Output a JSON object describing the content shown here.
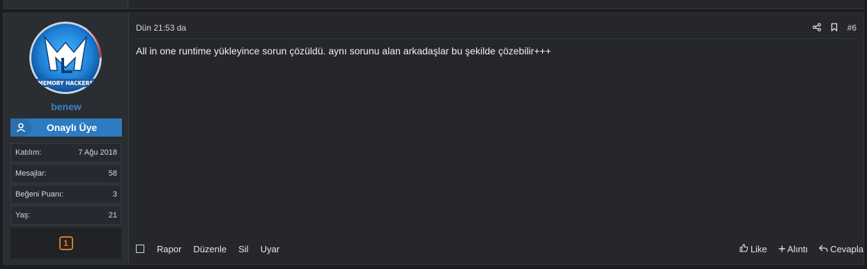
{
  "post": {
    "author": {
      "username": "benew",
      "avatar_text": "MEMORY HACKERS",
      "banner": "Onaylı Üye",
      "stats": [
        {
          "label": "Katılım:",
          "value": "7 Ağu 2018"
        },
        {
          "label": "Mesajlar:",
          "value": "58"
        },
        {
          "label": "Beğeni Puanı:",
          "value": "3"
        },
        {
          "label": "Yaş:",
          "value": "21"
        }
      ],
      "trophy_count": "1"
    },
    "timestamp": "Dün 21:53 da",
    "post_number": "#6",
    "message": "All in one runtime yükleyince sorun çözüldü. aynı sorunu alan arkadaşlar bu şekilde çözebilir+++",
    "actions_left": [
      "Rapor",
      "Düzenle",
      "Sil",
      "Uyar"
    ],
    "actions_right": [
      "Like",
      "Alıntı",
      "Cevapla"
    ]
  },
  "colors": {
    "accent": "#2d7bc0",
    "username": "#3b82c4",
    "trophy": "#e07a1d",
    "background": "#25272b"
  }
}
